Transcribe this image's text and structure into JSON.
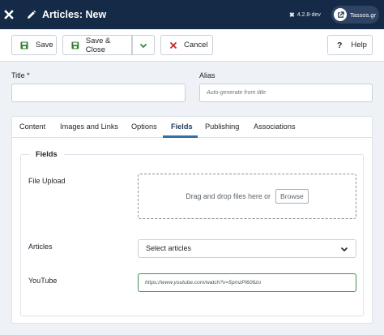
{
  "header": {
    "title": "Articles: New",
    "version": "4.2.8-dev",
    "user": "Tassos.gr"
  },
  "toolbar": {
    "save_label": "Save",
    "save_close_label": "Save & Close",
    "cancel_label": "Cancel",
    "help_label": "Help"
  },
  "form": {
    "title_label": "Title *",
    "alias_label": "Alias",
    "alias_placeholder": "Auto-generate from title"
  },
  "tabs": [
    {
      "label": "Content",
      "active": false
    },
    {
      "label": "Images and Links",
      "active": false
    },
    {
      "label": "Options",
      "active": false
    },
    {
      "label": "Fields",
      "active": true
    },
    {
      "label": "Publishing",
      "active": false
    },
    {
      "label": "Associations",
      "active": false
    }
  ],
  "fields": {
    "legend": "Fields",
    "file_upload_label": "File Upload",
    "dropzone_text": "Drag and drop files here or",
    "browse_label": "Browse",
    "articles_label": "Articles",
    "articles_value": "Select articles",
    "youtube_label": "YouTube",
    "youtube_placeholder": "https://www.youtube.com/watch?v=5pmzPl606zo"
  },
  "colors": {
    "header_bg": "#152a46",
    "save_icon": "#2f7d32",
    "cancel_icon": "#c52827",
    "active_tab": "#3071a9",
    "youtube_border": "#3f8e57"
  },
  "icons": [
    "joomla-logo-icon",
    "pencil-icon",
    "joomla-x-icon",
    "external-link-icon",
    "save-icon",
    "chevron-down-icon",
    "close-icon",
    "question-icon"
  ]
}
